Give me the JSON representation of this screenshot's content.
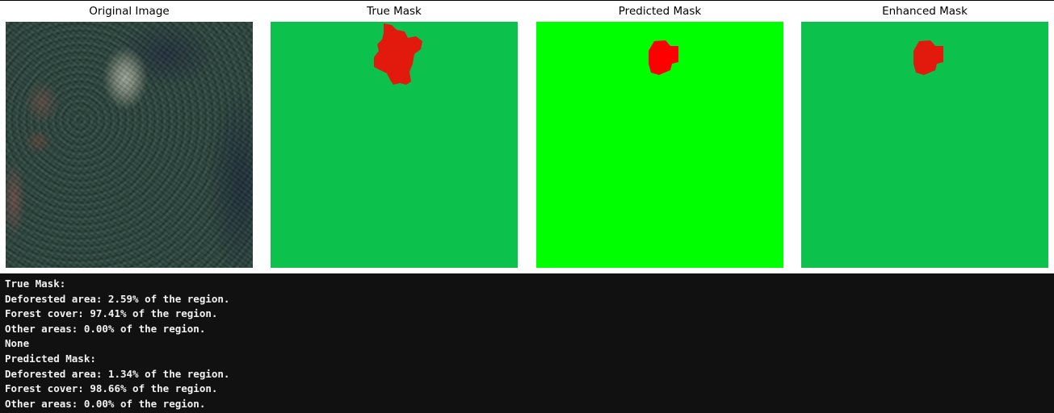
{
  "panels": [
    {
      "title": "Original Image",
      "kind": "image"
    },
    {
      "title": "True Mask",
      "kind": "mask",
      "background": "#0cc24d",
      "blob": "#e21a0e"
    },
    {
      "title": "Predicted Mask",
      "kind": "mask",
      "background": "#00ff00",
      "blob": "#ff0000"
    },
    {
      "title": "Enhanced Mask",
      "kind": "mask",
      "background": "#0cc24d",
      "blob": "#e21a0e"
    }
  ],
  "output_lines": [
    "True Mask:",
    "Deforested area: 2.59% of the region.",
    "Forest cover: 97.41% of the region.",
    "Other areas: 0.00% of the region.",
    "None",
    "Predicted Mask:",
    "Deforested area: 1.34% of the region.",
    "Forest cover: 98.66% of the region.",
    "Other areas: 0.00% of the region."
  ]
}
